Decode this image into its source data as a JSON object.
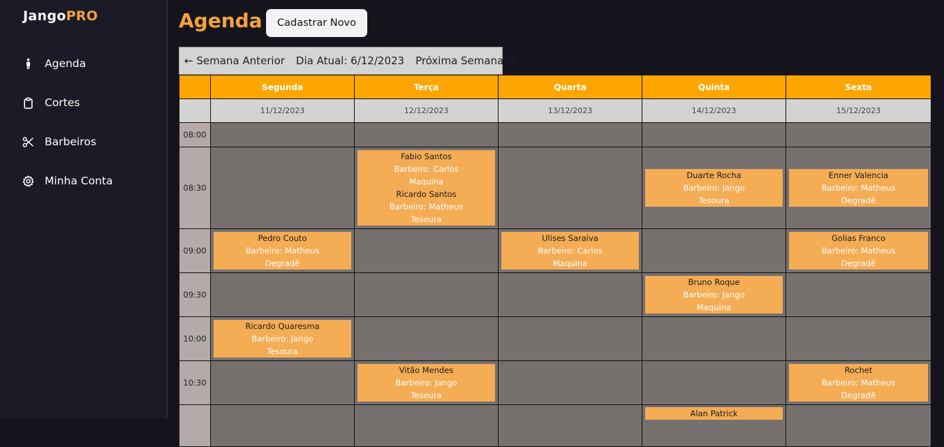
{
  "app": {
    "logo_main": "Jango",
    "logo_accent": "PRO"
  },
  "sidebar": {
    "items": [
      {
        "label": "Agenda",
        "icon": "person-icon"
      },
      {
        "label": "Cortes",
        "icon": "clipboard-icon"
      },
      {
        "label": "Barbeiros",
        "icon": "scissors-icon"
      },
      {
        "label": "Minha Conta",
        "icon": "gear-icon"
      }
    ]
  },
  "header": {
    "title": "Agenda",
    "new_button": "Cadastrar Novo"
  },
  "week_nav": {
    "prev": "← Semana Anterior",
    "current": "Dia Atual: 6/12/2023",
    "next": "Próxima Semana →"
  },
  "calendar": {
    "days": [
      "Segunda",
      "Terça",
      "Quarta",
      "Quinta",
      "Sexta"
    ],
    "dates": [
      "11/12/2023",
      "12/12/2023",
      "13/12/2023",
      "14/12/2023",
      "15/12/2023"
    ],
    "times": [
      "08:00",
      "08:30",
      "09:00",
      "09:30",
      "10:00",
      "10:30",
      ""
    ],
    "appointments": {
      "t1_d1": [
        [
          "Fabio Santos",
          "Barbeiro: Carlos",
          "Maquina"
        ],
        [
          "Ricardo Santos",
          "Barbeiro: Matheus",
          "Tesoura"
        ]
      ],
      "t1_d3": [
        [
          "Duarte Rocha",
          "Barbeiro: Jango",
          "Tesoura"
        ]
      ],
      "t1_d4": [
        [
          "Enner Valencia",
          "Barbeiro: Matheus",
          "Degradê"
        ]
      ],
      "t2_d0": [
        [
          "Pedro Couto",
          "Barbeiro: Matheus",
          "Degradê"
        ]
      ],
      "t2_d2": [
        [
          "Ulises Saraiva",
          "Barbeiro: Carlos",
          "Maquina"
        ]
      ],
      "t2_d4": [
        [
          "Golias Franco",
          "Barbeiro: Matheus",
          "Degradê"
        ]
      ],
      "t3_d3": [
        [
          "Bruno Roque",
          "Barbeiro: Jango",
          "Maquina"
        ]
      ],
      "t4_d0": [
        [
          "Ricardo Quaresma",
          "Barbeiro: Jango",
          "Tesoura"
        ]
      ],
      "t5_d1": [
        [
          "Vitão Mendes",
          "Barbeiro: Jango",
          "Tesoura"
        ]
      ],
      "t5_d4": [
        [
          "Rochet",
          "Barbeiro: Matheus",
          "Degradê"
        ]
      ],
      "t6_d3": [
        [
          "Alan Patrick",
          "",
          ""
        ]
      ]
    }
  },
  "colors": {
    "accent": "#f2a33a",
    "header_bg": "#fda602",
    "slot_bg": "#76706f",
    "appt_bg": "#f4ac55"
  }
}
